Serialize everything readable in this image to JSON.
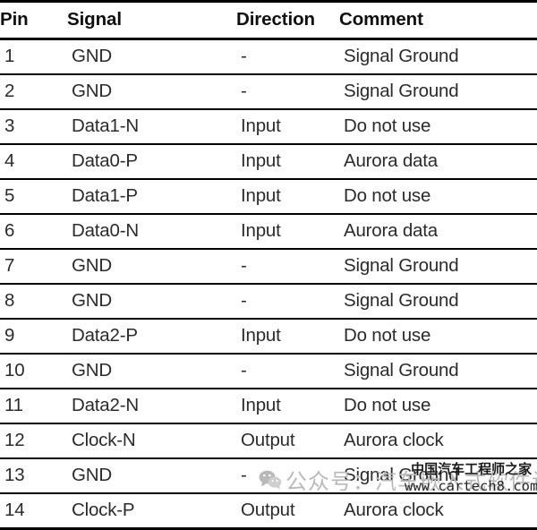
{
  "table": {
    "columns": [
      {
        "key": "pin",
        "label": "Pin"
      },
      {
        "key": "signal",
        "label": "Signal"
      },
      {
        "key": "direction",
        "label": "Direction"
      },
      {
        "key": "comment",
        "label": "Comment"
      }
    ],
    "rows": [
      {
        "pin": "1",
        "signal": "GND",
        "direction": "-",
        "comment": "Signal Ground"
      },
      {
        "pin": "2",
        "signal": "GND",
        "direction": "-",
        "comment": "Signal Ground"
      },
      {
        "pin": "3",
        "signal": "Data1-N",
        "direction": "Input",
        "comment": "Do not use"
      },
      {
        "pin": "4",
        "signal": "Data0-P",
        "direction": "Input",
        "comment": "Aurora data"
      },
      {
        "pin": "5",
        "signal": "Data1-P",
        "direction": "Input",
        "comment": "Do not use"
      },
      {
        "pin": "6",
        "signal": "Data0-N",
        "direction": "Input",
        "comment": "Aurora data"
      },
      {
        "pin": "7",
        "signal": "GND",
        "direction": "-",
        "comment": "Signal Ground"
      },
      {
        "pin": "8",
        "signal": "GND",
        "direction": "-",
        "comment": "Signal Ground"
      },
      {
        "pin": "9",
        "signal": "Data2-P",
        "direction": "Input",
        "comment": "Do not use"
      },
      {
        "pin": "10",
        "signal": "GND",
        "direction": "-",
        "comment": "Signal Ground"
      },
      {
        "pin": "11",
        "signal": "Data2-N",
        "direction": "Input",
        "comment": "Do not use"
      },
      {
        "pin": "12",
        "signal": "Clock-N",
        "direction": "Output",
        "comment": "Aurora clock"
      },
      {
        "pin": "13",
        "signal": "GND",
        "direction": "-",
        "comment": "Signal Ground"
      },
      {
        "pin": "14",
        "signal": "Clock-P",
        "direction": "Output",
        "comment": "Aurora clock"
      }
    ]
  },
  "watermark": {
    "icon": "wechat-icon",
    "account_text": "公众号：汽车嵌入式软件设计",
    "site_name": "中国汽车工程师之家",
    "site_url": "www.cartech8.com"
  },
  "colors": {
    "rule": "#000000",
    "header_text": "#0f0f0f",
    "body_text": "#2b2b2b",
    "watermark_light": "#b9b9b9",
    "watermark_dark": "#1a1a1a",
    "background": "#ffffff"
  }
}
